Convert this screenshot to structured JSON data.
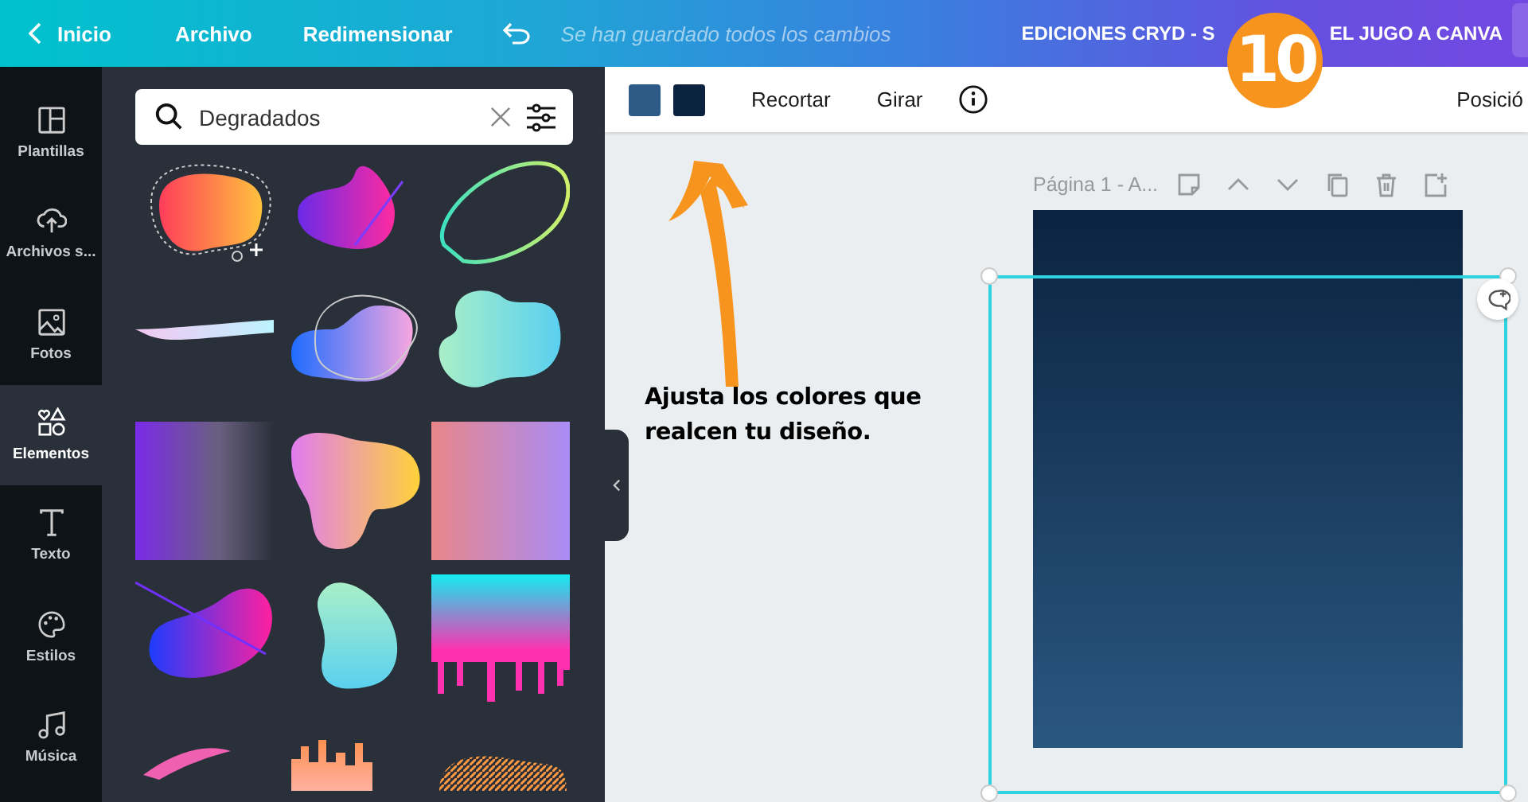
{
  "topbar": {
    "back": "Inicio",
    "menu": [
      "Archivo",
      "Redimensionar"
    ],
    "save_status": "Se han guardado todos los cambios",
    "title_start": "EDICIONES CRYD - S",
    "title_end": "EL JUGO A CANVA"
  },
  "step_badge": "10",
  "sidebar": {
    "items": [
      {
        "kind": "templates",
        "label": "Plantillas",
        "selected": false
      },
      {
        "kind": "uploads",
        "label": "Archivos s...",
        "selected": false
      },
      {
        "kind": "photos",
        "label": "Fotos",
        "selected": false
      },
      {
        "kind": "elements",
        "label": "Elementos",
        "selected": true
      },
      {
        "kind": "text",
        "label": "Texto",
        "selected": false
      },
      {
        "kind": "styles",
        "label": "Estilos",
        "selected": false
      },
      {
        "kind": "music",
        "label": "Música",
        "selected": false
      }
    ]
  },
  "search": {
    "value": "Degradados"
  },
  "toolbar": {
    "swatches": [
      {
        "color": "#2d5a86"
      },
      {
        "color": "#0c2340"
      }
    ],
    "buttons": [
      "Recortar",
      "Girar"
    ],
    "position": "Posició"
  },
  "page": {
    "label": "Página 1 - A..."
  },
  "annotation": "Ajusta los colores que realcen tu diseño."
}
